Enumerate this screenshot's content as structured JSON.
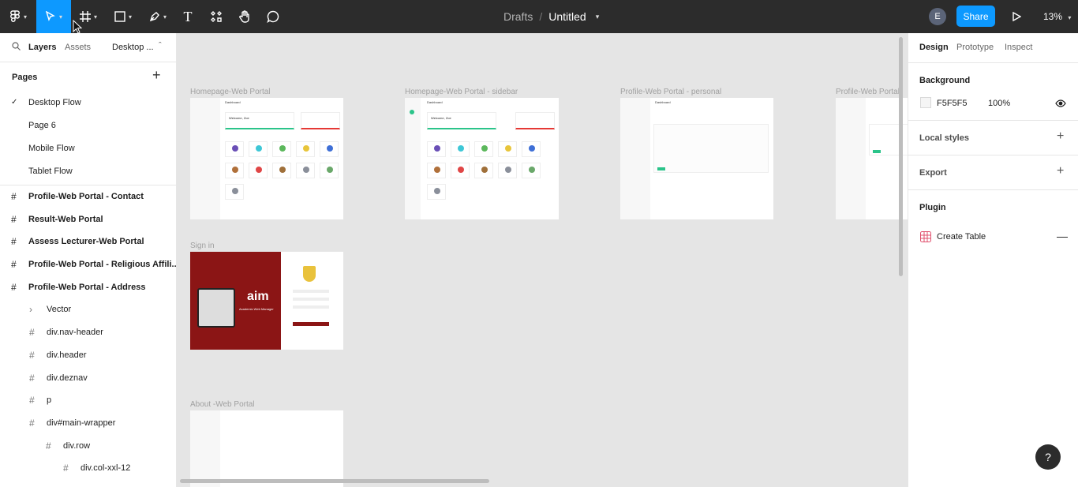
{
  "toolbar": {
    "breadcrumb_drafts": "Drafts",
    "breadcrumb_sep": "/",
    "file_name": "Untitled",
    "avatar_initial": "E",
    "share_label": "Share",
    "zoom_level": "13%",
    "text_tool_glyph": "T",
    "accent": "#0d99ff"
  },
  "left_panel": {
    "tabs": {
      "layers": "Layers",
      "assets": "Assets",
      "page_switch": "Desktop ..."
    },
    "pages_title": "Pages",
    "pages": [
      "Desktop Flow",
      "Page 6",
      "Mobile Flow",
      "Tablet Flow"
    ],
    "layers": [
      {
        "label": "Profile-Web Portal - Contact",
        "bold": true
      },
      {
        "label": "Result-Web Portal",
        "bold": true
      },
      {
        "label": "Assess Lecturer-Web Portal",
        "bold": true
      },
      {
        "label": "Profile-Web Portal - Religious Affili...",
        "bold": true
      },
      {
        "label": "Profile-Web Portal - Address",
        "bold": true
      },
      {
        "label": "Vector",
        "bold": false
      },
      {
        "label": "div.nav-header",
        "bold": false
      },
      {
        "label": "div.header",
        "bold": false
      },
      {
        "label": "div.deznav",
        "bold": false
      },
      {
        "label": "p",
        "bold": false
      },
      {
        "label": "div#main-wrapper",
        "bold": false
      },
      {
        "label": "div.row",
        "bold": false
      },
      {
        "label": "div.col-xxl-12",
        "bold": false
      }
    ]
  },
  "canvas": {
    "frames": {
      "homepage": "Homepage-Web Portal",
      "homepage_sidebar": "Homepage-Web Portal - sidebar",
      "profile_personal": "Profile-Web Portal - personal",
      "profile_cut": "Profile-Web Portal",
      "signin": "Sign in",
      "about": "About -Web Portal"
    },
    "aim_logo": "aim",
    "aim_subtitle": "Academic Web Manager",
    "dashboard_label": "Dashboard",
    "welcome": "Welcome, Zoe"
  },
  "right_panel": {
    "tabs": {
      "design": "Design",
      "prototype": "Prototype",
      "inspect": "Inspect"
    },
    "background_title": "Background",
    "bg_hex": "F5F5F5",
    "bg_opacity": "100%",
    "local_styles": "Local styles",
    "export": "Export",
    "plugin_title": "Plugin",
    "plugin_name": "Create Table",
    "swatch_color": "#f5f5f5"
  },
  "help_glyph": "?"
}
